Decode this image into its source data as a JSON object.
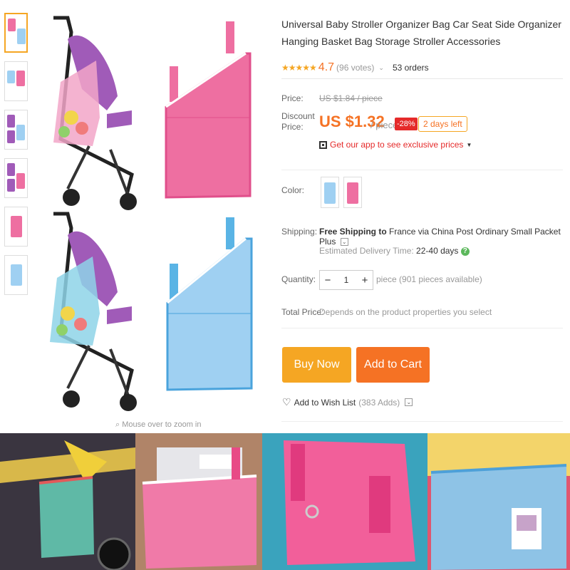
{
  "product": {
    "title": "Universal Baby Stroller Organizer Bag Car Seat Side Organizer Hanging Basket Bag Storage Stroller Accessories",
    "stars": "★★★★★",
    "rating": "4.7",
    "votes": "(96 votes)",
    "orders": "53 orders"
  },
  "price": {
    "label": "Price:",
    "original": "US $1.84 / piece",
    "discount_label": "Discount Price:",
    "current": "US $1.32",
    "unit": "/ piece",
    "discount_badge": "-28%",
    "days_left": "2 days left",
    "app_promo": "Get our app to see exclusive prices"
  },
  "color": {
    "label": "Color:"
  },
  "shipping": {
    "label": "Shipping:",
    "free": "Free Shipping",
    "to_text": "to",
    "country": "France",
    "via_text": "via China Post Ordinary Small Packet Plus",
    "delivery_label": "Estimated Delivery Time:",
    "delivery_value": "22-40 days"
  },
  "quantity": {
    "label": "Quantity:",
    "value": "1",
    "available": "piece (901 pieces available)"
  },
  "total": {
    "label": "Total Price:",
    "note": "Depends on the product properties you select"
  },
  "actions": {
    "buy_now": "Buy Now",
    "add_to_cart": "Add to Cart",
    "wish_list": "Add to Wish List",
    "wish_count": "(383 Adds)"
  },
  "gallery": {
    "zoom_hint": "Mouse over to zoom in"
  },
  "icons": {
    "star": "star-icon",
    "qr": "qr-code-icon",
    "heart": "heart-icon",
    "help": "help-icon",
    "chevron": "chevron-down-icon"
  },
  "colors": {
    "accent_orange": "#f57224",
    "buy_orange": "#f5a623",
    "sale_red": "#e52a2a",
    "bag_pink": "#ee6fa1",
    "bag_blue": "#9fd0f2",
    "stroller_purple": "#a05bb8"
  }
}
